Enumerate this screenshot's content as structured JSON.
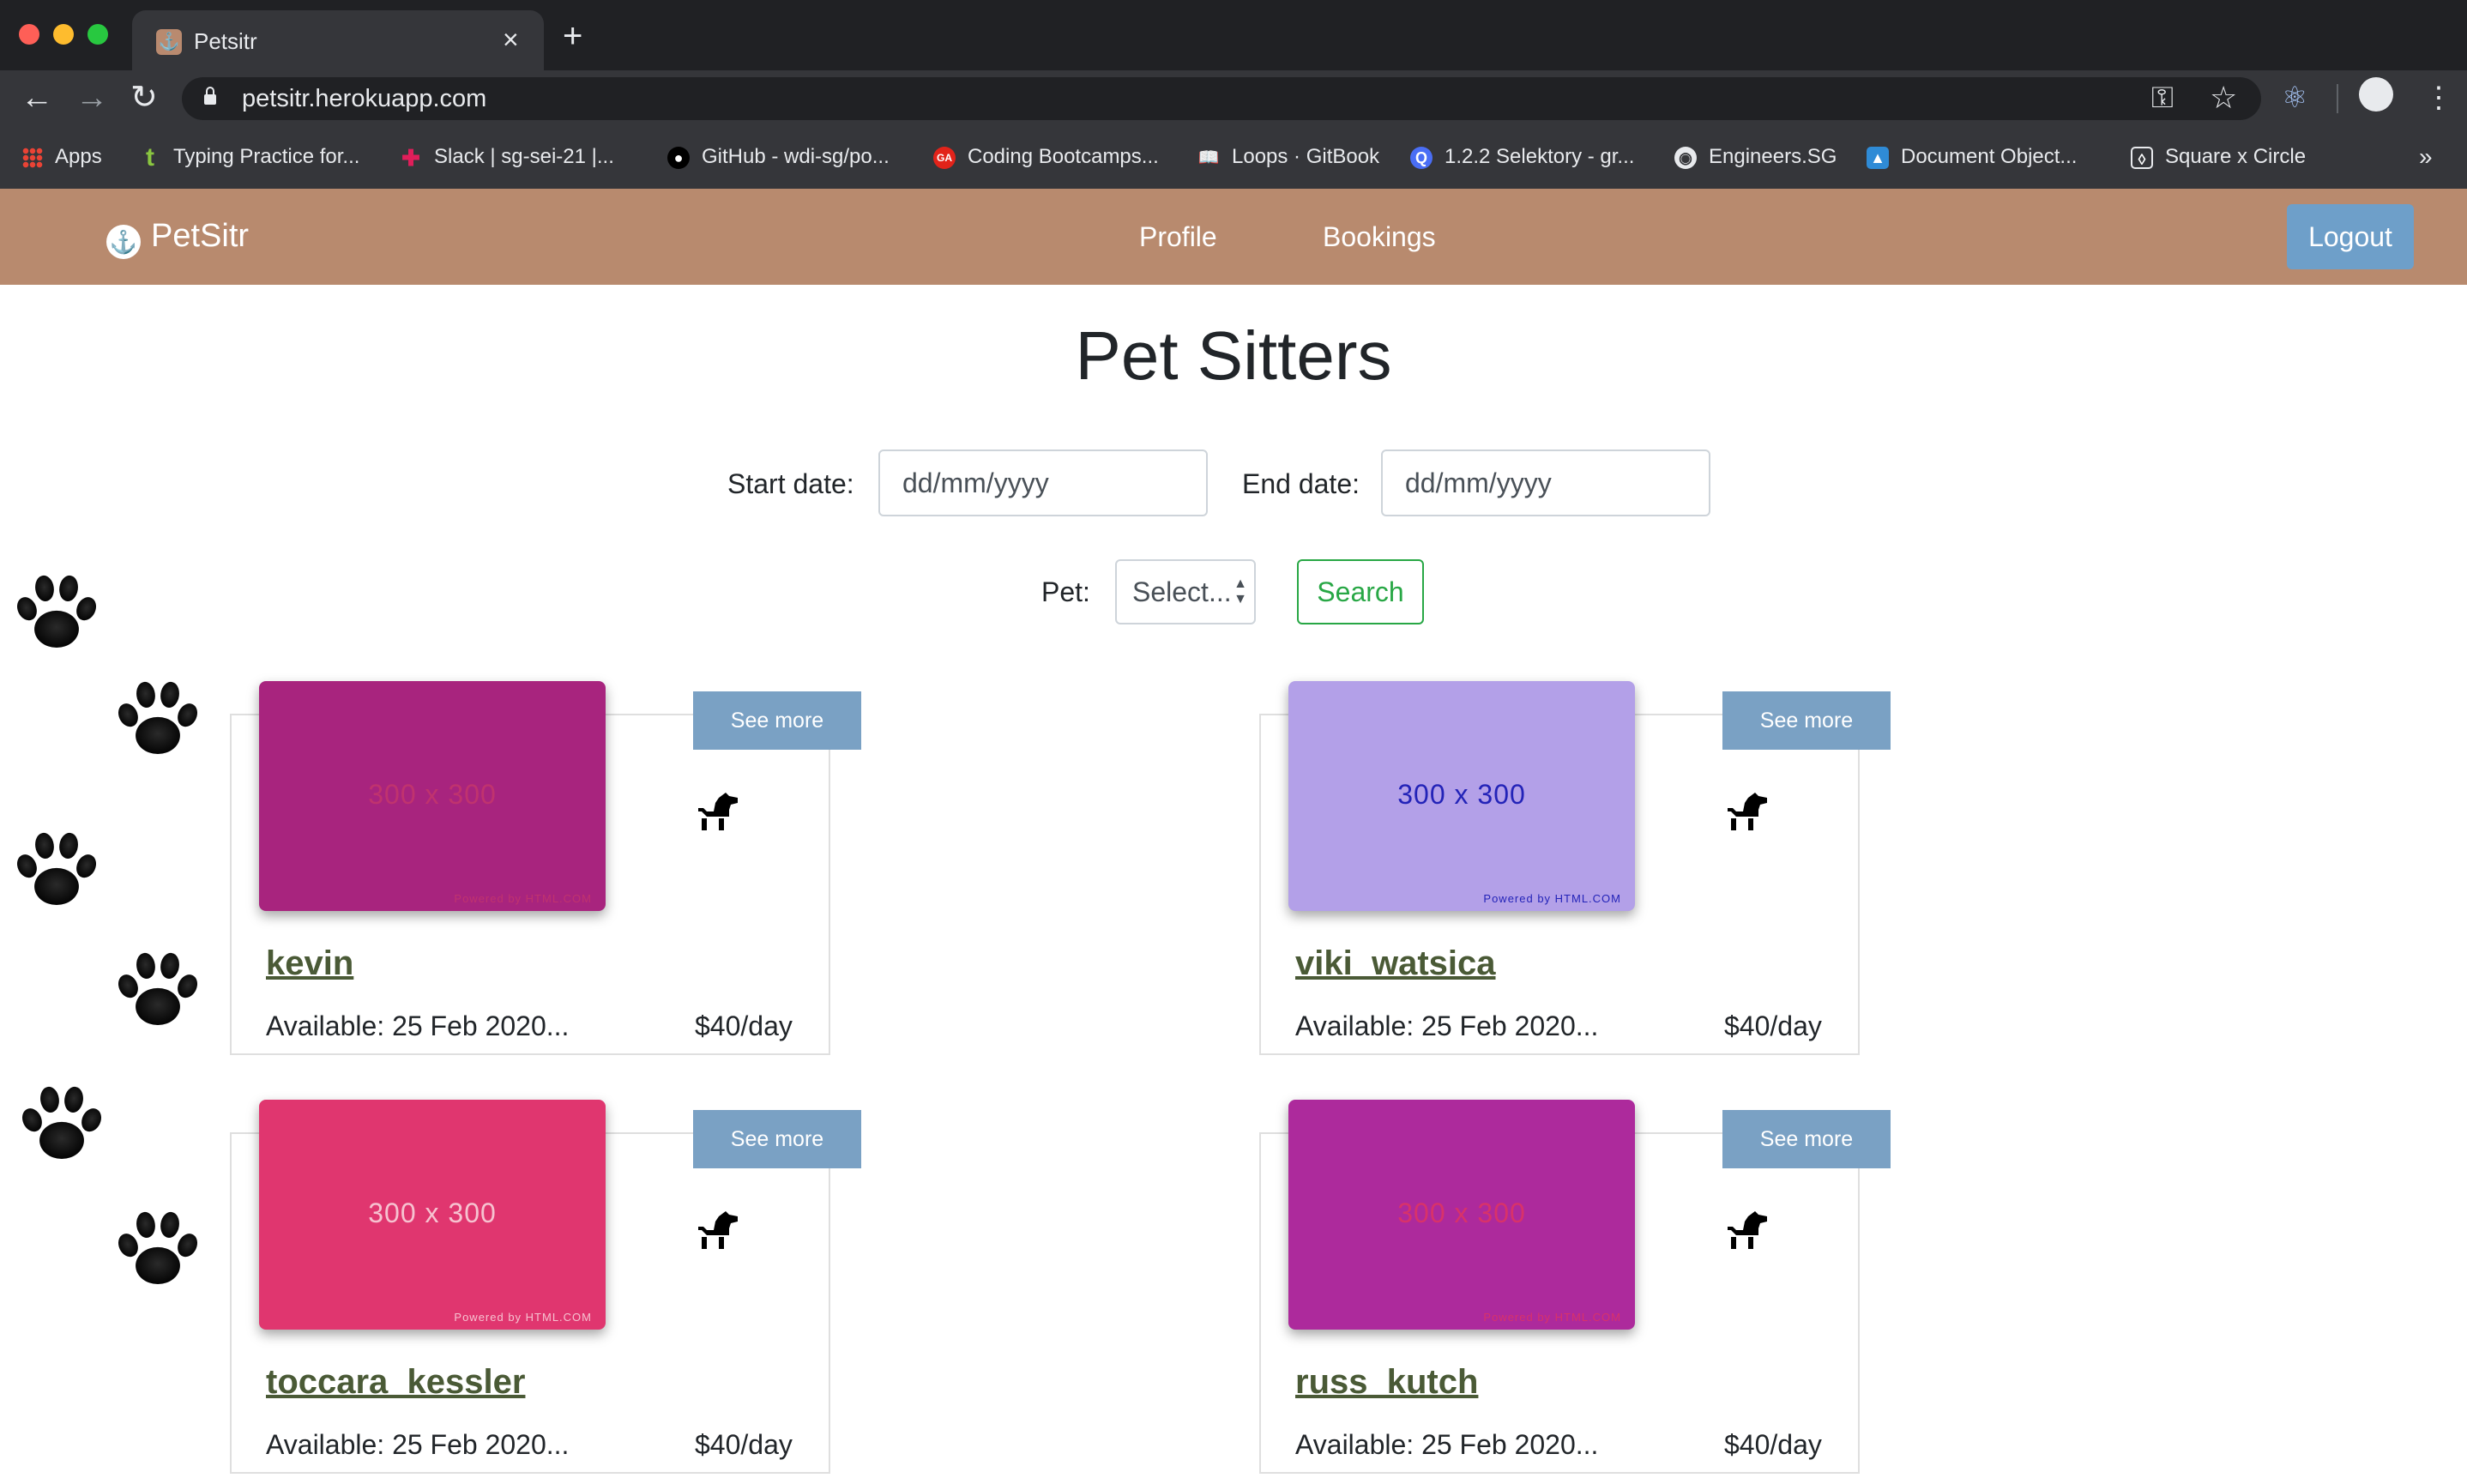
{
  "browser": {
    "tab_title": "Petsitr",
    "url": "petsitr.herokuapp.com",
    "bookmarks": [
      {
        "label": "Apps",
        "icon": "apps-grid-icon"
      },
      {
        "label": "Typing Practice for...",
        "icon": "t-icon"
      },
      {
        "label": "Slack | sg-sei-21 |...",
        "icon": "slack-icon"
      },
      {
        "label": "GitHub - wdi-sg/po...",
        "icon": "github-icon"
      },
      {
        "label": "Coding Bootcamps...",
        "icon": "ga-icon"
      },
      {
        "label": "Loops · GitBook",
        "icon": "gitbook-icon"
      },
      {
        "label": "1.2.2 Selektory - gr...",
        "icon": "q-icon"
      },
      {
        "label": "Engineers.SG",
        "icon": "globe-icon"
      },
      {
        "label": "Document Object...",
        "icon": "doc-icon"
      },
      {
        "label": "Square x Circle",
        "icon": "square-circle-icon"
      }
    ],
    "more_bookmarks": "»"
  },
  "navbar": {
    "brand": "PetSitr",
    "links": [
      "Profile",
      "Bookings"
    ],
    "logout_label": "Logout",
    "color": "#b88a6e"
  },
  "page": {
    "title": "Pet Sitters",
    "start_label": "Start date:",
    "start_placeholder": "dd/mm/yyyy",
    "end_label": "End date:",
    "end_placeholder": "dd/mm/yyyy",
    "pet_label": "Pet:",
    "pet_select_value": "Select...",
    "search_label": "Search"
  },
  "sitters": [
    {
      "name": "kevin",
      "available": "Available: 25 Feb 2020...",
      "price": "$40/day",
      "see_more": "See more",
      "thumb_text": "300 x 300",
      "thumb_powered": "Powered by HTML.COM",
      "thumb_bg": "#a8247e",
      "thumb_fg": "#c0336e"
    },
    {
      "name": "viki_watsica",
      "available": "Available: 25 Feb 2020...",
      "price": "$40/day",
      "see_more": "See more",
      "thumb_text": "300 x 300",
      "thumb_powered": "Powered by HTML.COM",
      "thumb_bg": "#b3a0e8",
      "thumb_fg": "#2323b8"
    },
    {
      "name": "toccara_kessler",
      "available": "Available: 25 Feb 2020...",
      "price": "$40/day",
      "see_more": "See more",
      "thumb_text": "300 x 300",
      "thumb_powered": "Powered by HTML.COM",
      "thumb_bg": "#e0366f",
      "thumb_fg": "#f6c2d0"
    },
    {
      "name": "russ_kutch",
      "available": "Available: 25 Feb 2020...",
      "price": "$40/day",
      "see_more": "See more",
      "thumb_text": "300 x 300",
      "thumb_powered": "Powered by HTML.COM",
      "thumb_bg": "#ad2a9c",
      "thumb_fg": "#d8326a"
    }
  ]
}
